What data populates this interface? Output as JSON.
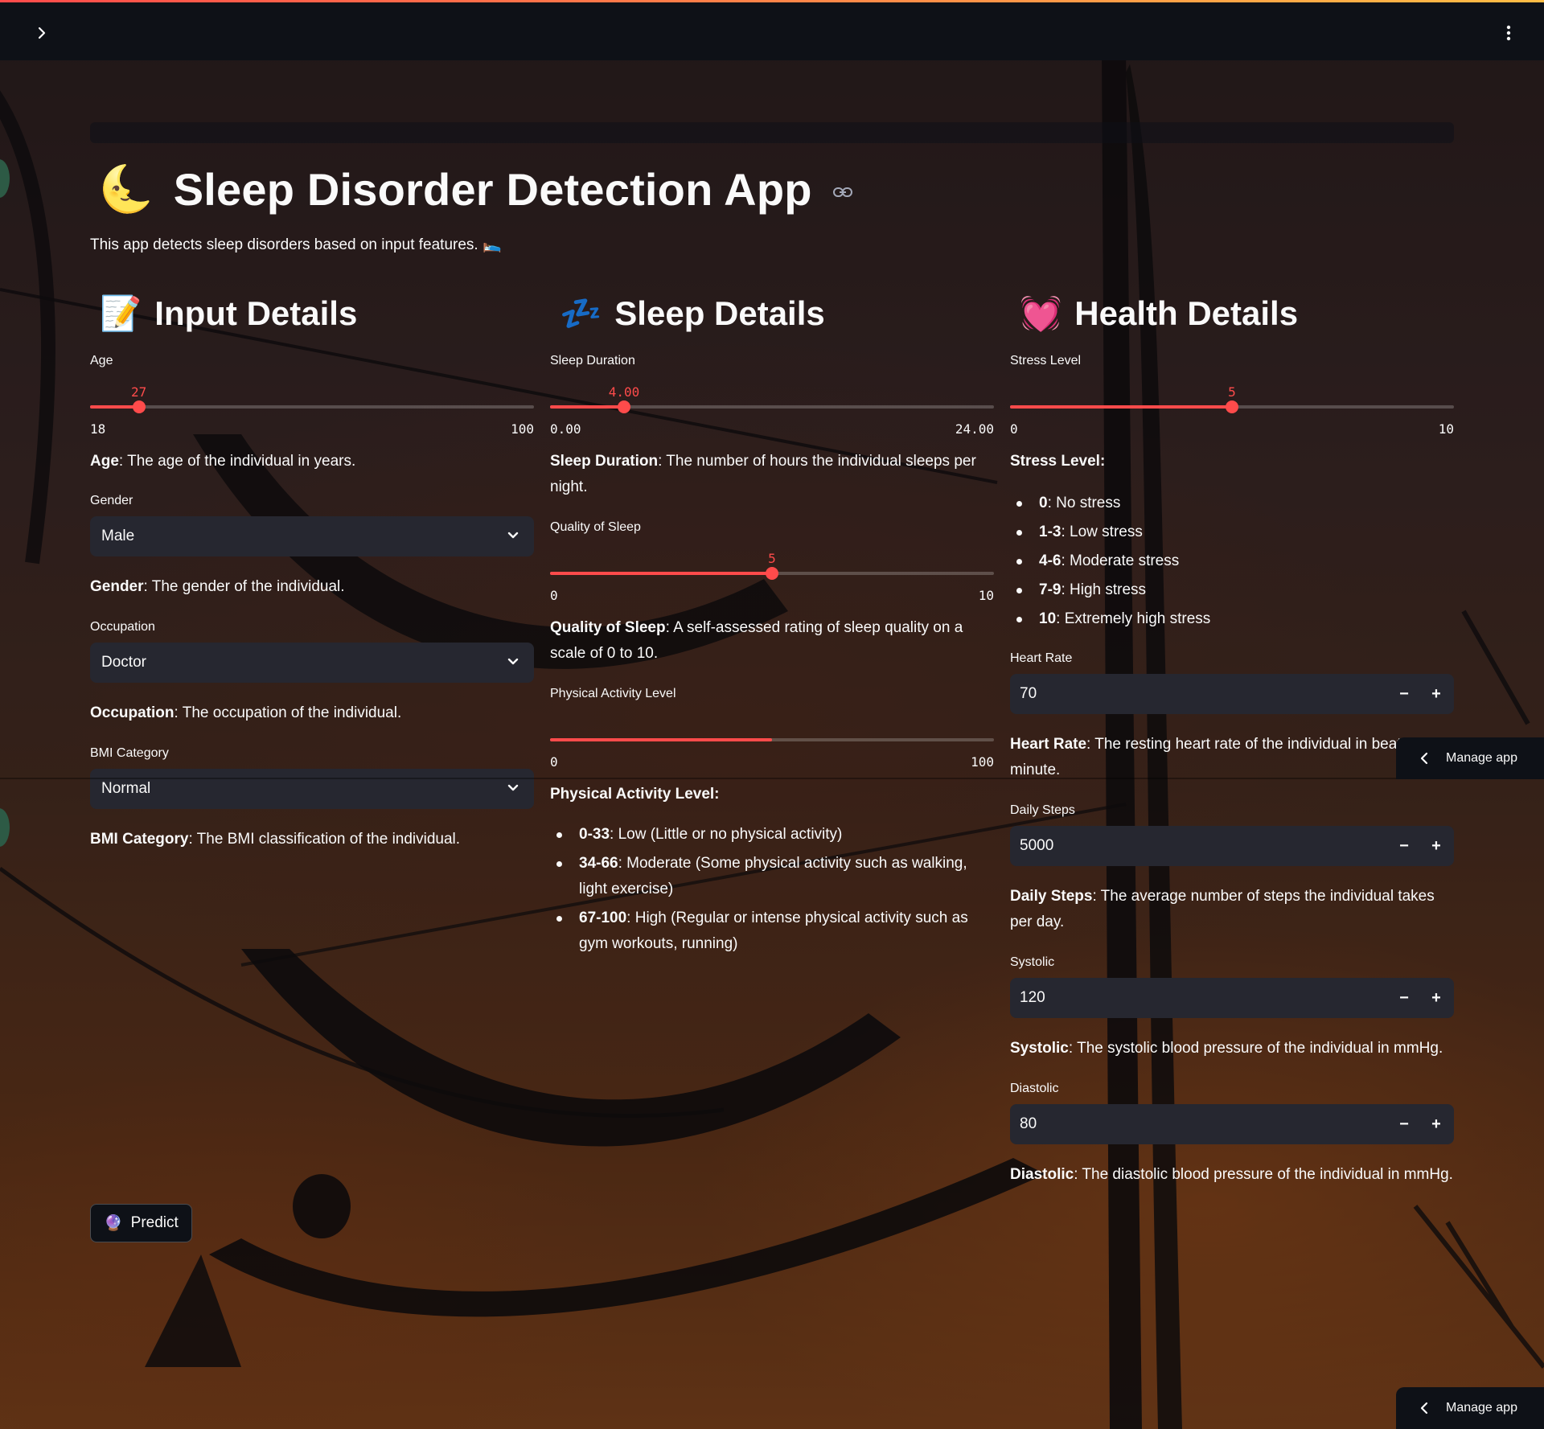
{
  "header": {
    "expand_icon": "chevron-right-icon",
    "menu_icon": "more-vertical-icon"
  },
  "app": {
    "title_emoji": "🌜",
    "title": "Sleep Disorder Detection App",
    "subtitle": "This app detects sleep disorders based on input features. 🛌"
  },
  "input_details": {
    "emoji": "📝",
    "heading": "Input Details",
    "age": {
      "label": "Age",
      "value": "27",
      "min": "18",
      "max": "100",
      "fraction": 0.1098
    },
    "age_desc": {
      "bold": "Age",
      "text": ": The age of the individual in years."
    },
    "gender": {
      "label": "Gender",
      "value": "Male"
    },
    "gender_desc": {
      "bold": "Gender",
      "text": ": The gender of the individual."
    },
    "occupation": {
      "label": "Occupation",
      "value": "Doctor"
    },
    "occupation_desc": {
      "bold": "Occupation",
      "text": ": The occupation of the individual."
    },
    "bmi": {
      "label": "BMI Category",
      "value": "Normal"
    },
    "bmi_desc": {
      "bold": "BMI Category",
      "text": ": The BMI classification of the individual."
    }
  },
  "sleep_details": {
    "emoji": "💤",
    "heading": "Sleep Details",
    "duration": {
      "label": "Sleep Duration",
      "value": "4.00",
      "min": "0.00",
      "max": "24.00",
      "fraction": 0.1667
    },
    "duration_desc": {
      "bold": "Sleep Duration",
      "text": ": The number of hours the individual sleeps per night."
    },
    "quality": {
      "label": "Quality of Sleep",
      "value": "5",
      "min": "0",
      "max": "10",
      "fraction": 0.5
    },
    "quality_desc": {
      "bold": "Quality of Sleep",
      "text": ": A self-assessed rating of sleep quality on a scale of 0 to 10."
    },
    "activity": {
      "label": "Physical Activity Level",
      "min": "0",
      "max": "100",
      "fraction": 0.5
    },
    "activity_title": "Physical Activity Level:",
    "activity_items": [
      {
        "bold": "0-33",
        "text": ": Low (Little or no physical activity)"
      },
      {
        "bold": "34-66",
        "text": ": Moderate (Some physical activity such as walking, light exercise)"
      },
      {
        "bold": "67-100",
        "text": ": High (Regular or intense physical activity such as gym workouts, running)"
      }
    ]
  },
  "health_details": {
    "emoji": "💓",
    "heading": "Health Details",
    "stress": {
      "label": "Stress Level",
      "value": "5",
      "min": "0",
      "max": "10",
      "fraction": 0.5
    },
    "stress_title": "Stress Level:",
    "stress_items": [
      {
        "bold": "0",
        "text": ": No stress"
      },
      {
        "bold": "1-3",
        "text": ": Low stress"
      },
      {
        "bold": "4-6",
        "text": ": Moderate stress"
      },
      {
        "bold": "7-9",
        "text": ": High stress"
      },
      {
        "bold": "10",
        "text": ": Extremely high stress"
      }
    ],
    "heart_rate": {
      "label": "Heart Rate",
      "value": "70"
    },
    "heart_rate_desc": {
      "bold": "Heart Rate",
      "text": ": The resting heart rate of the individual in beats per minute."
    },
    "daily_steps": {
      "label": "Daily Steps",
      "value": "5000"
    },
    "daily_steps_desc": {
      "bold": "Daily Steps",
      "text": ": The average number of steps the individual takes per day."
    },
    "systolic": {
      "label": "Systolic",
      "value": "120"
    },
    "systolic_desc": {
      "bold": "Systolic",
      "text": ": The systolic blood pressure of the individual in mmHg."
    },
    "diastolic": {
      "label": "Diastolic",
      "value": "80"
    },
    "diastolic_desc": {
      "bold": "Diastolic",
      "text": ": The diastolic blood pressure of the individual in mmHg."
    },
    "minus": "−",
    "plus": "+"
  },
  "predict_button": {
    "emoji": "🔮",
    "label": "Predict"
  },
  "manage_app": {
    "label": "Manage app"
  },
  "colors": {
    "accent": "#ff4b4b",
    "widget_bg": "#262730",
    "header_bg": "#0e1117"
  }
}
